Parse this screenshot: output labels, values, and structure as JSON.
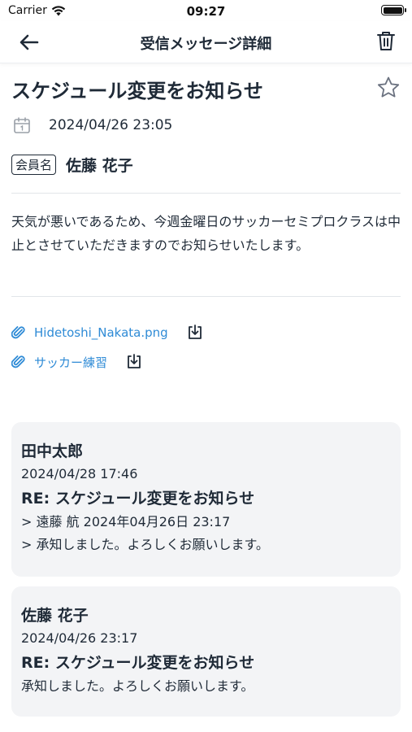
{
  "status_bar": {
    "carrier": "Carrier",
    "time": "09:27"
  },
  "nav": {
    "title": "受信メッセージ詳細"
  },
  "message": {
    "subject": "スケジュール変更をお知らせ",
    "date": "2024/04/26 23:05",
    "member_tag": "会員名",
    "member_name": "佐藤 花子",
    "body": "天気が悪いであるため、今週金曜日のサッカーセミプロクラスは中止とさせていただきますのでお知らせいたします。"
  },
  "attachments": [
    {
      "name": "Hidetoshi_Nakata.png"
    },
    {
      "name": "サッカー練習"
    }
  ],
  "replies": [
    {
      "sender": "田中太郎",
      "date": "2024/04/28 17:46",
      "subject": "RE: スケジュール変更をお知らせ",
      "lines": [
        "> 遠藤 航 2024年04月26日 23:17",
        "> 承知しました。よろしくお願いします。"
      ]
    },
    {
      "sender": "佐藤 花子",
      "date": "2024/04/26 23:17",
      "subject": "RE: スケジュール変更をお知らせ",
      "lines": [
        "承知しました。よろしくお願いします。"
      ]
    }
  ],
  "icons": {
    "back": "arrow-left-icon",
    "trash": "trash-icon",
    "star": "star-outline-icon",
    "calendar": "calendar-icon",
    "attachment": "paperclip-icon",
    "download": "download-icon"
  },
  "colors": {
    "text": "#1f2a37",
    "link": "#2f8bd6",
    "card_bg": "#f3f4f6"
  }
}
